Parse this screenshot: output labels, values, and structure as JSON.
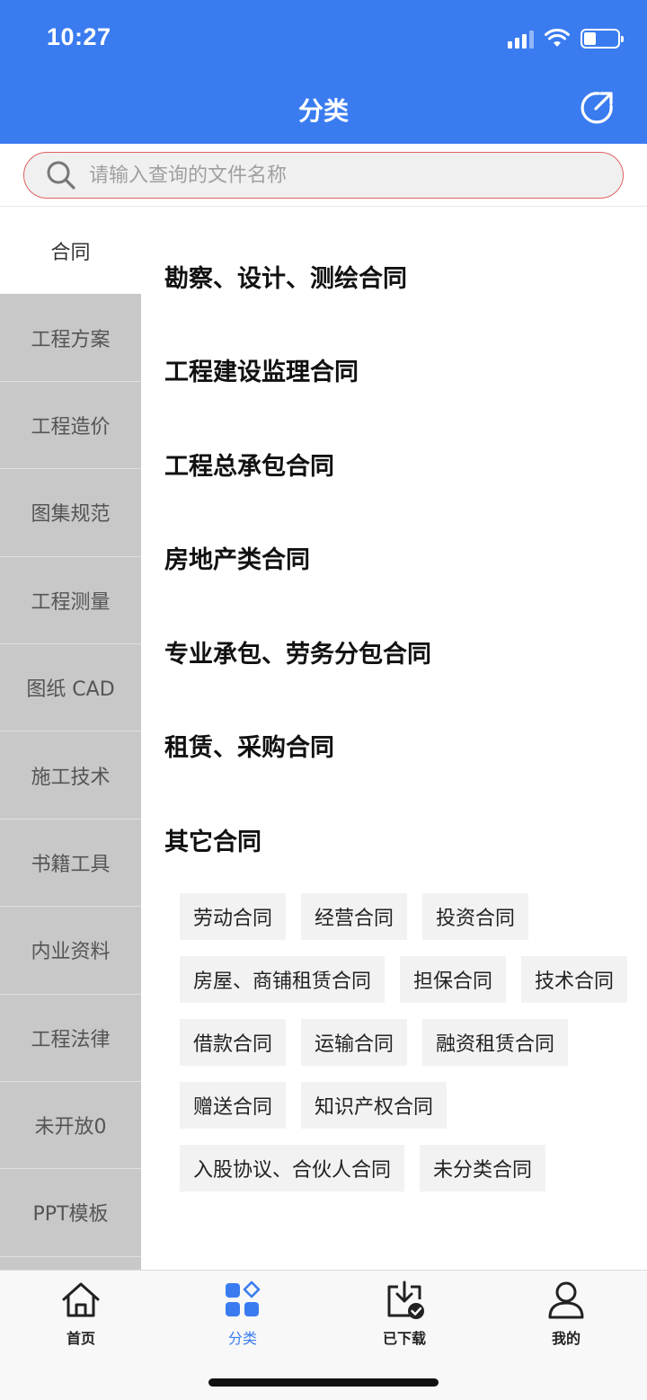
{
  "status_bar": {
    "time": "10:27",
    "battery_level": 0.35
  },
  "header": {
    "title": "分类",
    "share_icon": "share-icon",
    "bg_color": "#3a7cf0"
  },
  "search": {
    "placeholder": "请输入查询的文件名称",
    "value": ""
  },
  "sidebar": {
    "items": [
      {
        "label": "合同",
        "active": true
      },
      {
        "label": "工程方案"
      },
      {
        "label": "工程造价"
      },
      {
        "label": "图集规范"
      },
      {
        "label": "工程测量"
      },
      {
        "label": "图纸 CAD"
      },
      {
        "label": "施工技术"
      },
      {
        "label": "书籍工具"
      },
      {
        "label": "内业资料"
      },
      {
        "label": "工程法律"
      },
      {
        "label": "未开放0"
      },
      {
        "label": "PPT模板"
      }
    ]
  },
  "content": {
    "categories": [
      "勘察、设计、测绘合同",
      "工程建设监理合同",
      "工程总承包合同",
      "房地产类合同",
      "专业承包、劳务分包合同",
      "租赁、采购合同",
      "其它合同"
    ],
    "tags": [
      "劳动合同",
      "经营合同",
      "投资合同",
      "房屋、商铺租赁合同",
      "担保合同",
      "技术合同",
      "借款合同",
      "运输合同",
      "融资租赁合同",
      "赠送合同",
      "知识产权合同",
      "入股协议、合伙人合同",
      "未分类合同"
    ]
  },
  "tabbar": {
    "tabs": [
      {
        "label": "首页",
        "icon": "home-icon"
      },
      {
        "label": "分类",
        "icon": "category-icon",
        "active": true
      },
      {
        "label": "已下载",
        "icon": "download-icon"
      },
      {
        "label": "我的",
        "icon": "user-icon"
      }
    ],
    "active_color": "#3a7cf0"
  }
}
